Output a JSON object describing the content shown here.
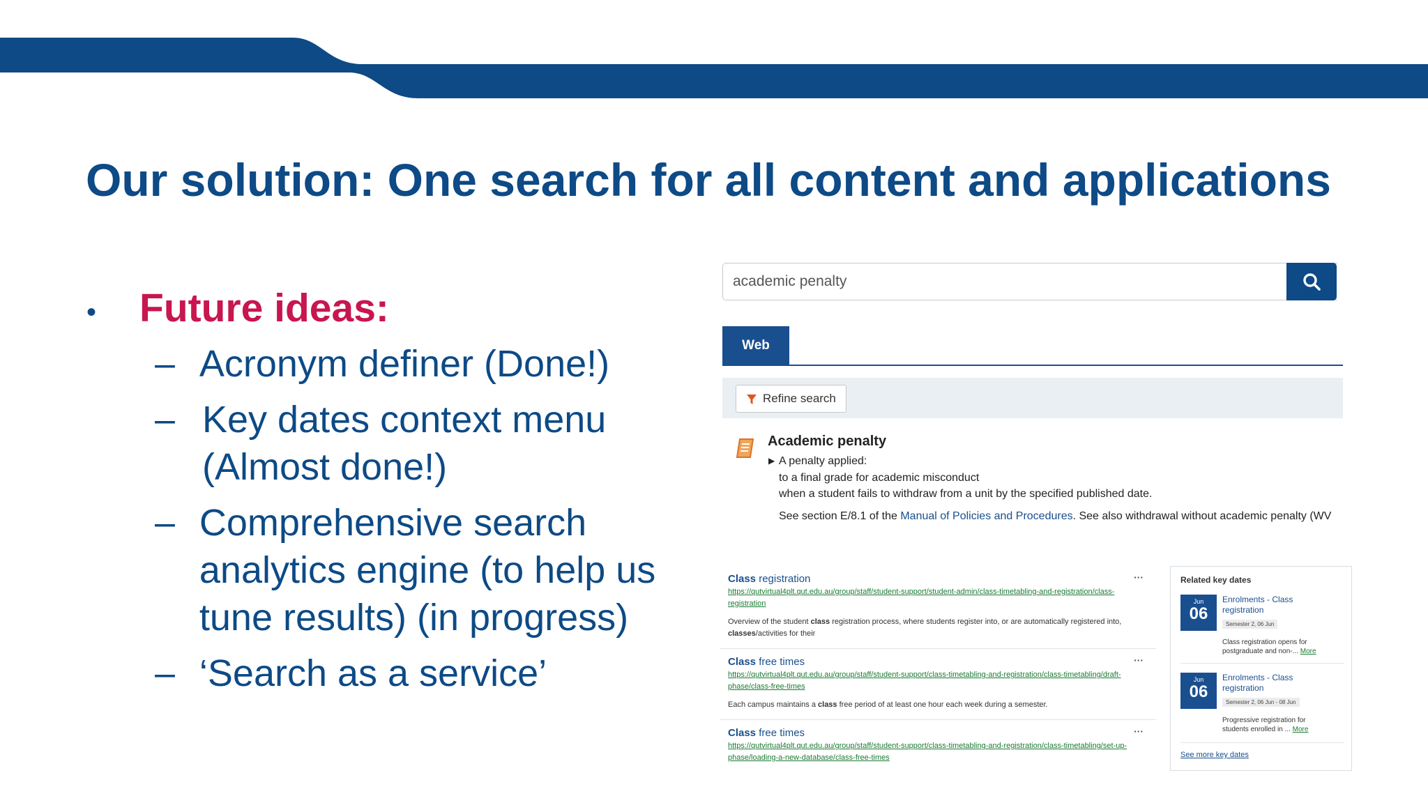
{
  "slide": {
    "title": "Our solution: One search for all content and applications",
    "bullet_main": "Future ideas:",
    "sub_items": [
      "Acronym definer (Done!)",
      "Key dates context menu (Almost done!)",
      "Comprehensive search analytics engine (to help us tune results) (in progress)",
      "‘Search as a service’"
    ],
    "dash": "–",
    "bullet_dot": "•"
  },
  "colors": {
    "brand_blue": "#0d4a86",
    "accent_red": "#c8164f",
    "link_green": "#1b7a34"
  },
  "search": {
    "query": "academic penalty",
    "clear_glyph": "✖",
    "tab": "Web",
    "refine_label": "Refine search"
  },
  "acronym": {
    "title": "Academic penalty",
    "line1": "A penalty applied:",
    "line2": "to a final grade for academic misconduct",
    "line3": "when a student fails to withdraw from a unit by the specified published date.",
    "see_pre": "See section E/8.1 of the ",
    "see_link": "Manual of Policies and Procedures",
    "see_post": ". See also withdrawal without academic penalty (WV",
    "icon": "book-icon"
  },
  "results": [
    {
      "title_bold": "Class",
      "title_rest": " registration",
      "url": "https://qutvirtual4plt.qut.edu.au/group/staff/student-support/student-admin/class-timetabling-and-registration/class-registration",
      "desc_html_parts": [
        "Overview of the student ",
        "class",
        " registration process, where students register into, or are automatically registered into, ",
        "classes",
        "/activities for their"
      ],
      "more": "···"
    },
    {
      "title_bold": "Class",
      "title_rest": " free times",
      "url": "https://qutvirtual4plt.qut.edu.au/group/staff/student-support/class-timetabling-and-registration/class-timetabling/draft-phase/class-free-times",
      "desc_html_parts": [
        "Each campus maintains a ",
        "class",
        " free period of at least one hour each week during a semester."
      ],
      "more": "···"
    },
    {
      "title_bold": "Class",
      "title_rest": " free times",
      "url": "https://qutvirtual4plt.qut.edu.au/group/staff/student-support/class-timetabling-and-registration/class-timetabling/set-up-phase/loading-a-new-database/class-free-times",
      "desc_html_parts": [],
      "more": "···"
    }
  ],
  "keydates": {
    "heading": "Related key dates",
    "items": [
      {
        "month": "Jun",
        "day": "06",
        "title": "Enrolments - Class registration",
        "semester": "Semester 2, 06 Jun",
        "desc": "Class registration opens for postgraduate and non-...",
        "more": "More"
      },
      {
        "month": "Jun",
        "day": "06",
        "title": "Enrolments - Class registration",
        "semester": "Semester 2, 06 Jun - 08 Jun",
        "desc": "Progressive registration for students enrolled in ...",
        "more": "More"
      }
    ],
    "see_more": "See more key dates"
  }
}
